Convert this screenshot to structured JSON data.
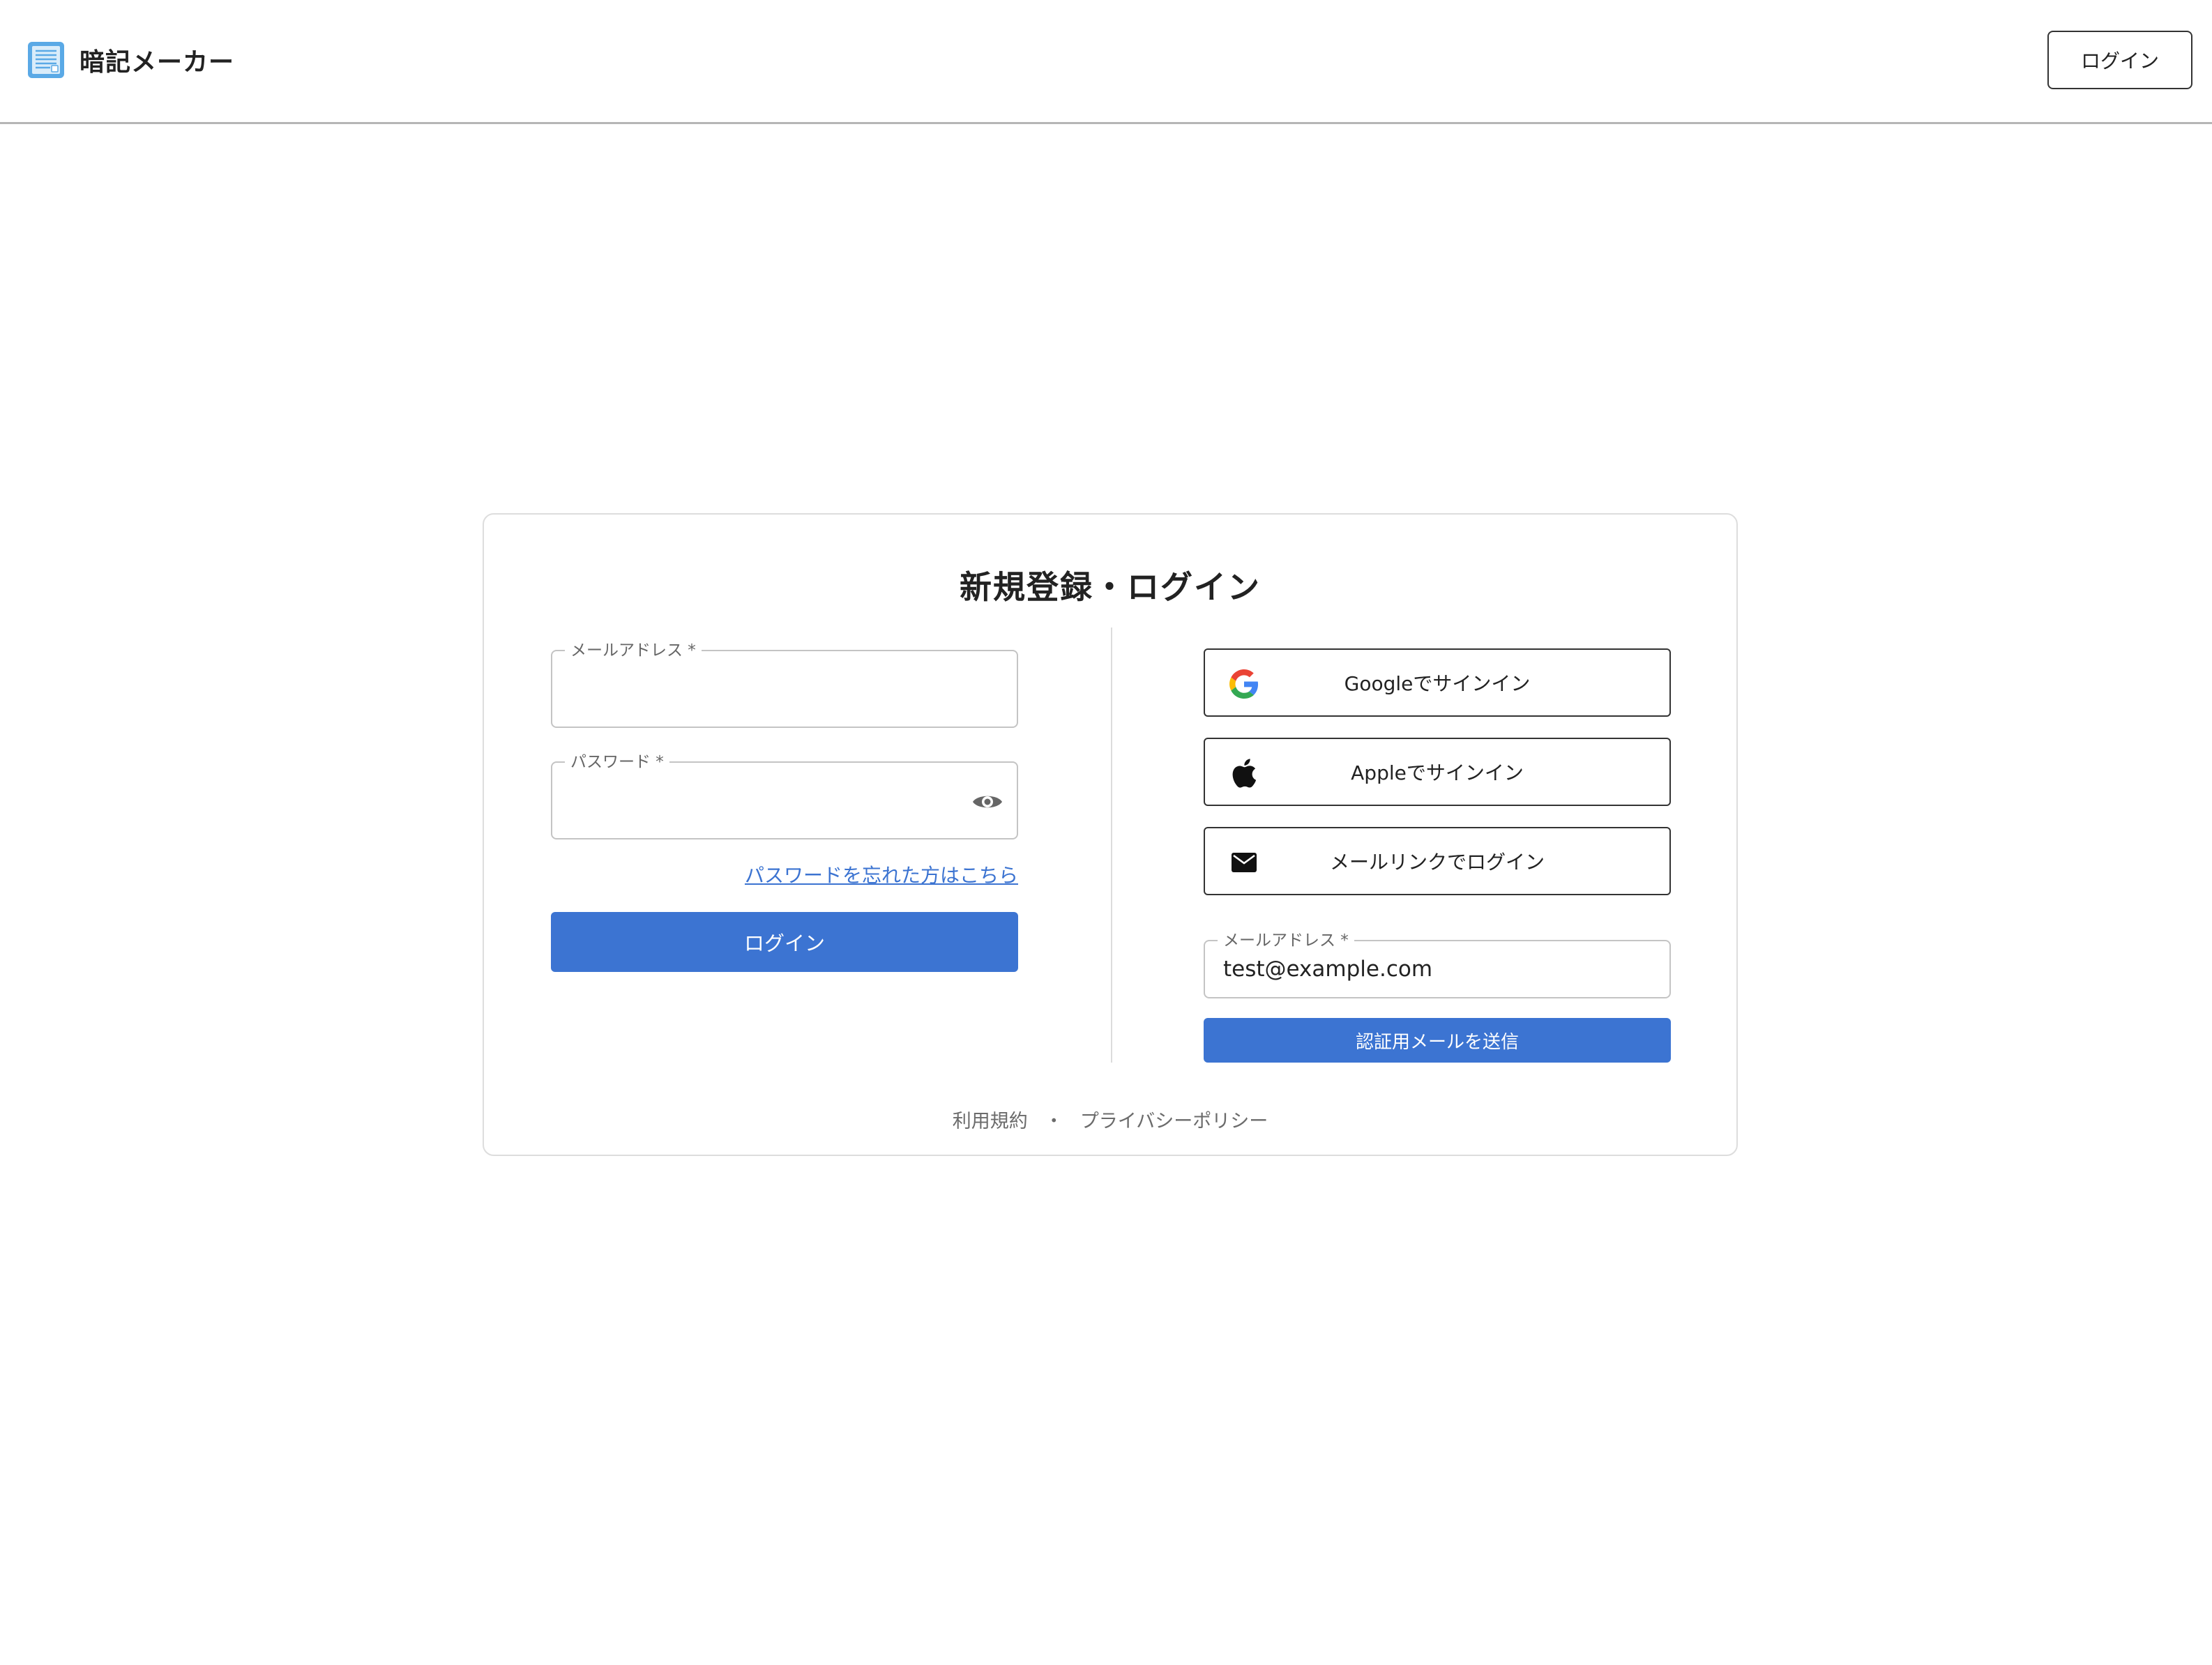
{
  "header": {
    "app_name": "暗記メーカー",
    "login_button": "ログイン"
  },
  "card": {
    "title": "新規登録・ログイン"
  },
  "login_form": {
    "email_label": "メールアドレス *",
    "email_value": "",
    "password_label": "パスワード *",
    "password_value": "",
    "forgot_password": "パスワードを忘れた方はこちら",
    "submit": "ログイン"
  },
  "social": {
    "google": "Googleでサインイン",
    "apple": "Appleでサインイン",
    "mail_link": "メールリンクでログイン"
  },
  "mail_link_form": {
    "email_label": "メールアドレス *",
    "email_value": "test@example.com",
    "send_button": "認証用メールを送信"
  },
  "footer": {
    "terms": "利用規約",
    "separator": "・",
    "privacy": "プライバシーポリシー"
  },
  "colors": {
    "primary": "#3c74d2",
    "link": "#3b73d1",
    "logo": "#5aa9e6"
  },
  "icons": {
    "logo": "notebook-icon",
    "eye": "eye-icon",
    "google": "google-icon",
    "apple": "apple-icon",
    "mail": "mail-icon"
  }
}
